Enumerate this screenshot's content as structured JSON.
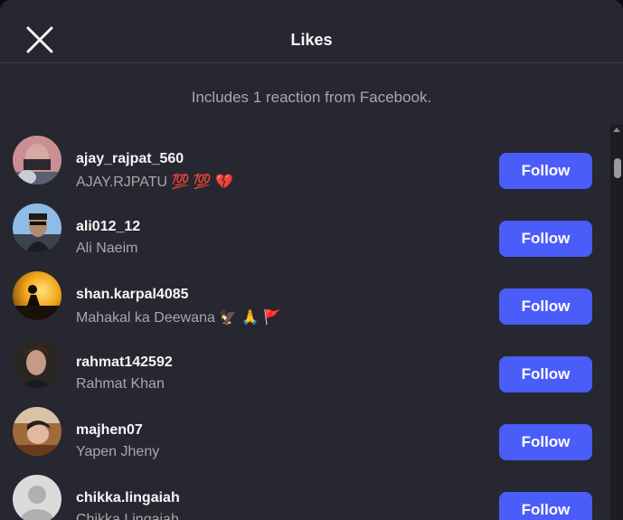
{
  "header": {
    "title": "Likes",
    "close_icon": "close-icon"
  },
  "subtitle": "Includes 1 reaction from Facebook.",
  "users": [
    {
      "username": "ajay_rajpat_560",
      "name": "AJAY.RJPATU 💯 💯 💔",
      "button": "Follow",
      "avatar": "avatar-masked-person"
    },
    {
      "username": "ali012_12",
      "name": "Ali Naeim",
      "button": "Follow",
      "avatar": "avatar-man-sunglasses"
    },
    {
      "username": "shan.karpal4085",
      "name": "Mahakal ka Deewana 🦅 🙏 🚩",
      "button": "Follow",
      "avatar": "avatar-sunset-silhouette"
    },
    {
      "username": "rahmat142592",
      "name": "Rahmat Khan",
      "button": "Follow",
      "avatar": "avatar-young-man"
    },
    {
      "username": "majhen07",
      "name": "Yapen Jheny",
      "button": "Follow",
      "avatar": "avatar-person-indoor"
    },
    {
      "username": "chikka.lingaiah",
      "name": "Chikka Lingaiah",
      "button": "Follow",
      "avatar": "avatar-default"
    }
  ],
  "colors": {
    "background": "#262730",
    "follow_button": "#4a5df9",
    "secondary_text": "#a8a8a8"
  }
}
